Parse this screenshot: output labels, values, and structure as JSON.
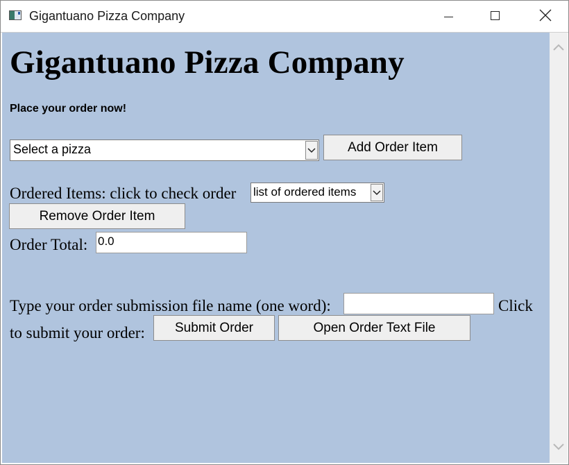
{
  "window": {
    "title": "Gigantuano Pizza Company"
  },
  "page": {
    "heading": "Gigantuano Pizza Company",
    "subheading": "Place your order now!",
    "pizza_select": {
      "selected": "Select a pizza"
    },
    "add_button": "Add Order Item",
    "ordered_items_label": "Ordered Items: click to check order",
    "ordered_items_select": {
      "selected": "list of ordered items"
    },
    "remove_button": "Remove Order Item",
    "order_total_label": "Order Total:",
    "order_total_value": "0.0",
    "filename_label": "Type your order submission file name (one word):",
    "filename_value": "",
    "click_word": "Click",
    "submit_label": "to submit your order:",
    "submit_button": "Submit Order",
    "open_button": "Open Order Text File"
  },
  "icons": {
    "app": "app-window-icon",
    "minimize": "minimize-icon",
    "maximize": "maximize-icon",
    "close": "close-icon",
    "scroll_up": "chevron-up-icon",
    "scroll_down": "chevron-down-icon",
    "dropdown": "chevron-down-icon"
  },
  "colors": {
    "page_background": "#b0c4de",
    "button_face": "#efefef"
  }
}
